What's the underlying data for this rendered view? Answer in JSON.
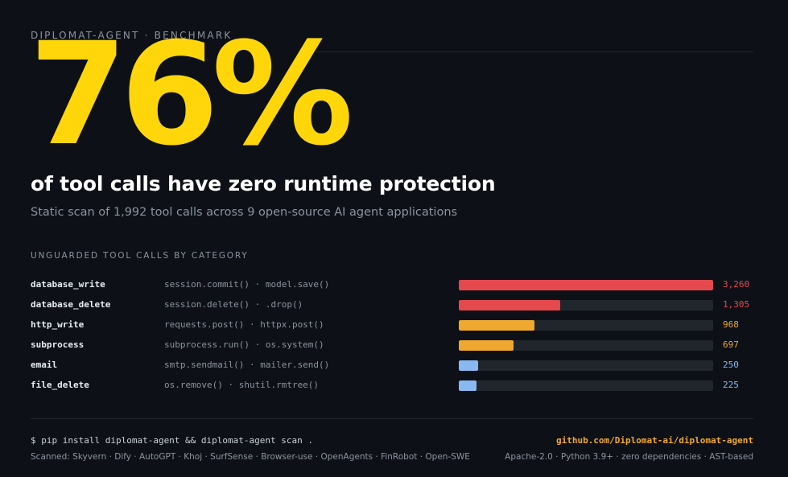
{
  "header": {
    "eyebrow": "DIPLOMAT-AGENT · BENCHMARK",
    "big_stat": "76%",
    "headline": "of tool calls have zero runtime protection",
    "subhead": "Static scan of 1,992 tool calls across 9 open-source AI agent applications"
  },
  "section_label": "UNGUARDED TOOL CALLS BY CATEGORY",
  "chart_data": {
    "type": "bar",
    "orientation": "horizontal",
    "xlim": [
      0,
      3260
    ],
    "categories": [
      "database_write",
      "database_delete",
      "http_write",
      "subprocess",
      "email",
      "file_delete"
    ],
    "examples": [
      "session.commit() · model.save()",
      "session.delete() · .drop()",
      "requests.post() · httpx.post()",
      "subprocess.run() · os.system()",
      "smtp.sendmail() · mailer.send()",
      "os.remove() · shutil.rmtree()"
    ],
    "values": [
      3260,
      1305,
      968,
      697,
      250,
      225
    ],
    "value_labels": [
      "3,260",
      "1,305",
      "968",
      "697",
      "250",
      "225"
    ],
    "colors": [
      "#e5484d",
      "#e5484d",
      "#f0a830",
      "#f0a830",
      "#8ab8f0",
      "#8ab8f0"
    ],
    "track_color": "#21262d"
  },
  "footer": {
    "command": "$ pip install diplomat-agent && diplomat-agent scan .",
    "scanned": "Scanned: Skyvern · Dify · AutoGPT · Khoj · SurfSense · Browser-use · OpenAgents · FinRobot · Open-SWE",
    "repo": "github.com/Diplomat-ai/diplomat-agent",
    "meta": "Apache-2.0 · Python 3.9+ · zero dependencies · AST-based"
  },
  "colors": {
    "background": "#0d1117",
    "accent": "#ffd60a",
    "link": "#f0a830"
  }
}
